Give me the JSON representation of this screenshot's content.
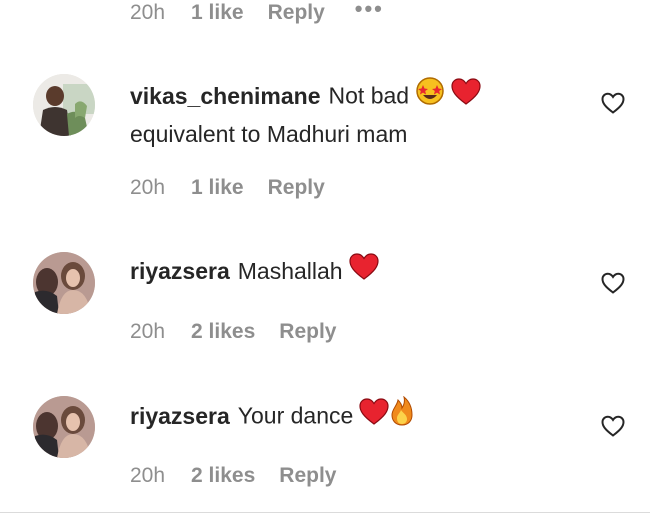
{
  "top": {
    "time": "20h",
    "likes": "1 like",
    "reply": "Reply",
    "more": "•••"
  },
  "comments": [
    {
      "username": "vikas_chenimane",
      "text": "Not bad",
      "text_line2": "equivalent to Madhuri mam",
      "emojis": [
        "star-struck-face",
        "red-heart"
      ],
      "time": "20h",
      "likes": "1 like",
      "reply": "Reply"
    },
    {
      "username": "riyazsera",
      "text": "Mashallah",
      "emojis": [
        "red-heart"
      ],
      "time": "20h",
      "likes": "2 likes",
      "reply": "Reply"
    },
    {
      "username": "riyazsera",
      "text": "Your dance",
      "emojis": [
        "red-heart",
        "fire"
      ],
      "time": "20h",
      "likes": "2 likes",
      "reply": "Reply"
    }
  ],
  "colors": {
    "text": "#262626",
    "meta": "#8e8e8e",
    "heart": "#ed1c3a",
    "divider": "#dbdbdb"
  }
}
